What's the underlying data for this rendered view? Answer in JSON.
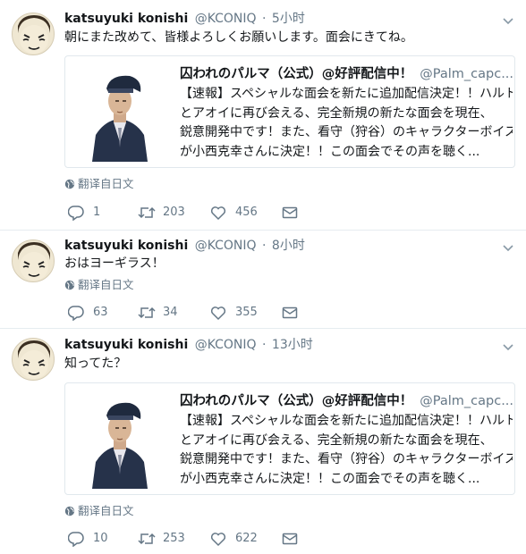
{
  "tweets": [
    {
      "name": "katsuyuki konishi",
      "handle": "@KCONIQ",
      "dot": "·",
      "time": "5小时",
      "text": "朝にまた改めて、皆様よろしくお願いします。面会にきてね。",
      "card": {
        "title": "囚われのパルマ（公式）@好評配信中！",
        "handle": "@Palm_capc...",
        "lines": [
          "【速報】スペシャルな面会を新たに追加配信決定！！ハルト",
          "とアオイに再び会える、完全新規の新たな面会を現在、",
          "鋭意開発中です！また、看守（狩谷）のキャラクターボイス",
          "が小西克幸さんに決定！！この面会でその声を聴く..."
        ]
      },
      "translate": "翻译自日文",
      "replies": "1",
      "retweets": "203",
      "likes": "456"
    },
    {
      "name": "katsuyuki konishi",
      "handle": "@KCONIQ",
      "dot": "·",
      "time": "8小时",
      "text": "おはヨーギラス！",
      "translate": "翻译自日文",
      "replies": "63",
      "retweets": "34",
      "likes": "355"
    },
    {
      "name": "katsuyuki konishi",
      "handle": "@KCONIQ",
      "dot": "·",
      "time": "13小时",
      "text": "知ってた？",
      "card": {
        "title": "囚われのパルマ（公式）@好評配信中！",
        "handle": "@Palm_capc...",
        "lines": [
          "【速報】スペシャルな面会を新たに追加配信決定！！ハルト",
          "とアオイに再び会える、完全新規の新たな面会を現在、",
          "鋭意開発中です！また、看守（狩谷）のキャラクターボイス",
          "が小西克幸さんに決定！！この面会でその声を聴く..."
        ]
      },
      "translate": "翻译自日文",
      "replies": "10",
      "retweets": "253",
      "likes": "622"
    }
  ],
  "colors": {
    "text": "#14171a",
    "muted": "#657786",
    "border": "#e6ecf0"
  }
}
